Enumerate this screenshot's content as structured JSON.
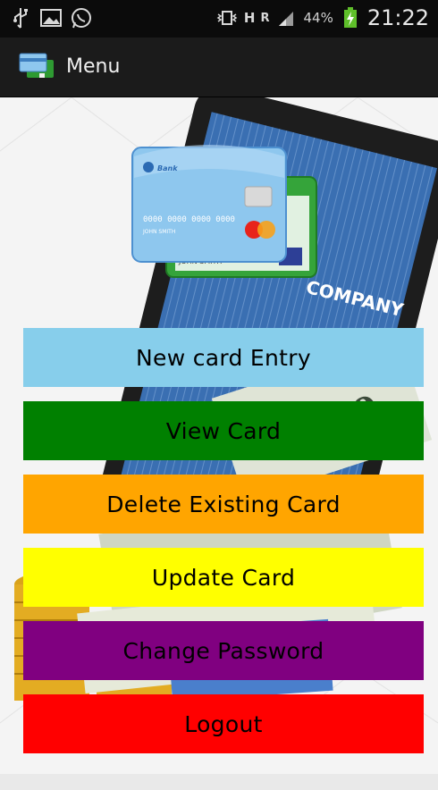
{
  "status_bar": {
    "battery_percent": "44%",
    "time": "21:22",
    "network_h": "H",
    "network_r": "R",
    "icons": [
      "usb-icon",
      "image-icon",
      "whatsapp-icon",
      "vibrate-icon",
      "signal-icon",
      "battery-charging-icon"
    ]
  },
  "action_bar": {
    "title": "Menu",
    "icon": "credit-cards-app-icon"
  },
  "background_art": {
    "bank_label": "Bank",
    "card_number": "0000 0000 0000 0000",
    "card_holder": "JOHN SMITH",
    "company_text": "COMPANY"
  },
  "menu": {
    "new_card": {
      "label": "New card Entry",
      "bg": "#87ceeb",
      "fg": "#000000"
    },
    "view_card": {
      "label": "View Card",
      "bg": "#008000",
      "fg": "#000000"
    },
    "delete_card": {
      "label": "Delete Existing Card",
      "bg": "#ffa500",
      "fg": "#000000"
    },
    "update_card": {
      "label": "Update Card",
      "bg": "#ffff00",
      "fg": "#000000"
    },
    "change_password": {
      "label": "Change Password",
      "bg": "#800080",
      "fg": "#000000"
    },
    "logout": {
      "label": "Logout",
      "bg": "#ff0000",
      "fg": "#000000"
    }
  }
}
